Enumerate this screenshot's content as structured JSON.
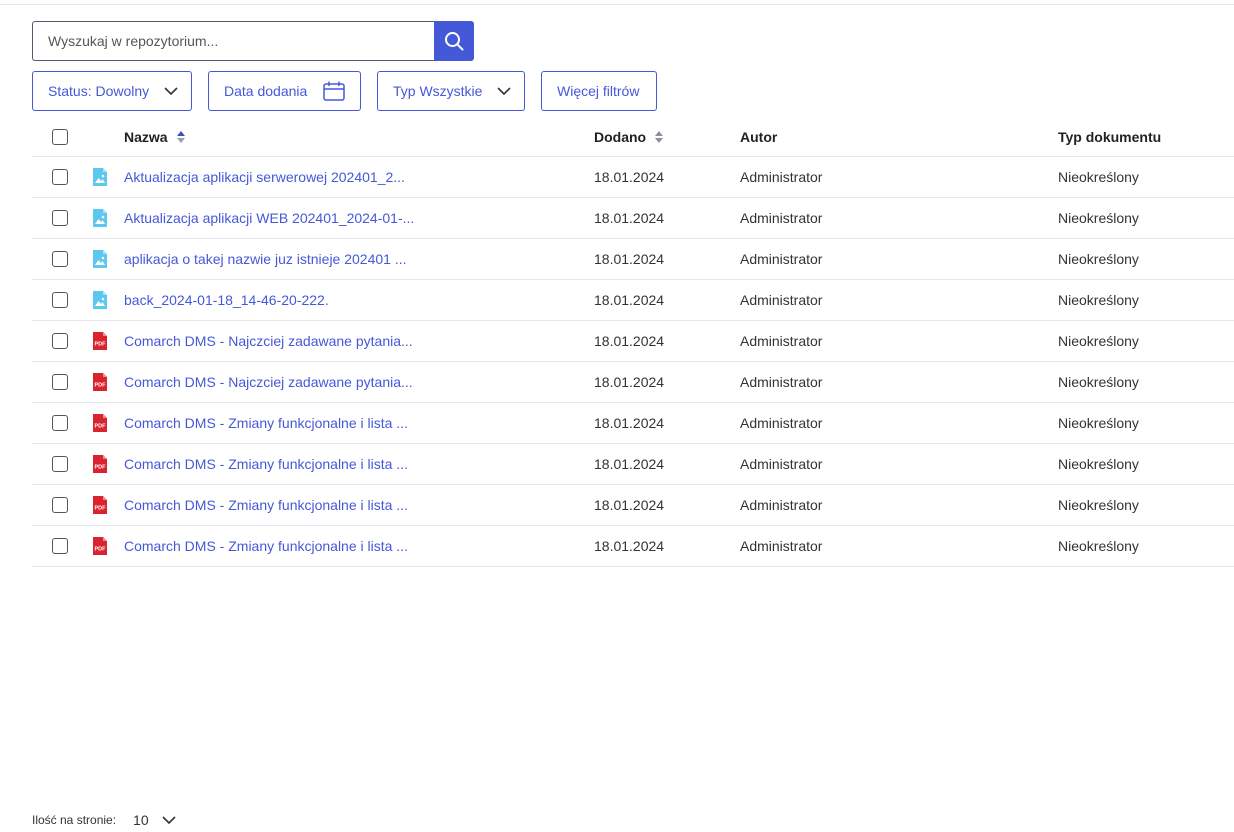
{
  "search": {
    "placeholder": "Wyszukaj w repozytorium...",
    "value": ""
  },
  "filters": {
    "status_label": "Status: Dowolny",
    "date_label": "Data dodania",
    "type_label": "Typ Wszystkie",
    "more_label": "Więcej filtrów"
  },
  "table": {
    "columns": {
      "name": "Nazwa",
      "added": "Dodano",
      "author": "Autor",
      "doc_type": "Typ dokumentu"
    },
    "rows": [
      {
        "icon": "image-file-icon",
        "name": "Aktualizacja aplikacji serwerowej 202401_2...",
        "added": "18.01.2024",
        "author": "Administrator",
        "doc_type": "Nieokreślony"
      },
      {
        "icon": "image-file-icon",
        "name": "Aktualizacja aplikacji WEB 202401_2024-01-...",
        "added": "18.01.2024",
        "author": "Administrator",
        "doc_type": "Nieokreślony"
      },
      {
        "icon": "image-file-icon",
        "name": "aplikacja o takej nazwie juz istnieje 202401 ...",
        "added": "18.01.2024",
        "author": "Administrator",
        "doc_type": "Nieokreślony"
      },
      {
        "icon": "image-file-icon",
        "name": "back_2024-01-18_14-46-20-222.",
        "added": "18.01.2024",
        "author": "Administrator",
        "doc_type": "Nieokreślony"
      },
      {
        "icon": "pdf-file-icon",
        "name": "Comarch DMS - Najczciej zadawane pytania...",
        "added": "18.01.2024",
        "author": "Administrator",
        "doc_type": "Nieokreślony"
      },
      {
        "icon": "pdf-file-icon",
        "name": "Comarch DMS - Najczciej zadawane pytania...",
        "added": "18.01.2024",
        "author": "Administrator",
        "doc_type": "Nieokreślony"
      },
      {
        "icon": "pdf-file-icon",
        "name": "Comarch DMS - Zmiany funkcjonalne i lista ...",
        "added": "18.01.2024",
        "author": "Administrator",
        "doc_type": "Nieokreślony"
      },
      {
        "icon": "pdf-file-icon",
        "name": "Comarch DMS - Zmiany funkcjonalne i lista ...",
        "added": "18.01.2024",
        "author": "Administrator",
        "doc_type": "Nieokreślony"
      },
      {
        "icon": "pdf-file-icon",
        "name": "Comarch DMS - Zmiany funkcjonalne i lista ...",
        "added": "18.01.2024",
        "author": "Administrator",
        "doc_type": "Nieokreślony"
      },
      {
        "icon": "pdf-file-icon",
        "name": "Comarch DMS - Zmiany funkcjonalne i lista ...",
        "added": "18.01.2024",
        "author": "Administrator",
        "doc_type": "Nieokreślony"
      }
    ]
  },
  "pager": {
    "label": "Ilość na stronie:",
    "value": "10"
  },
  "colors": {
    "accent": "#4558d8",
    "pdf_red": "#d9232e",
    "image_blue": "#5bc8f0"
  }
}
